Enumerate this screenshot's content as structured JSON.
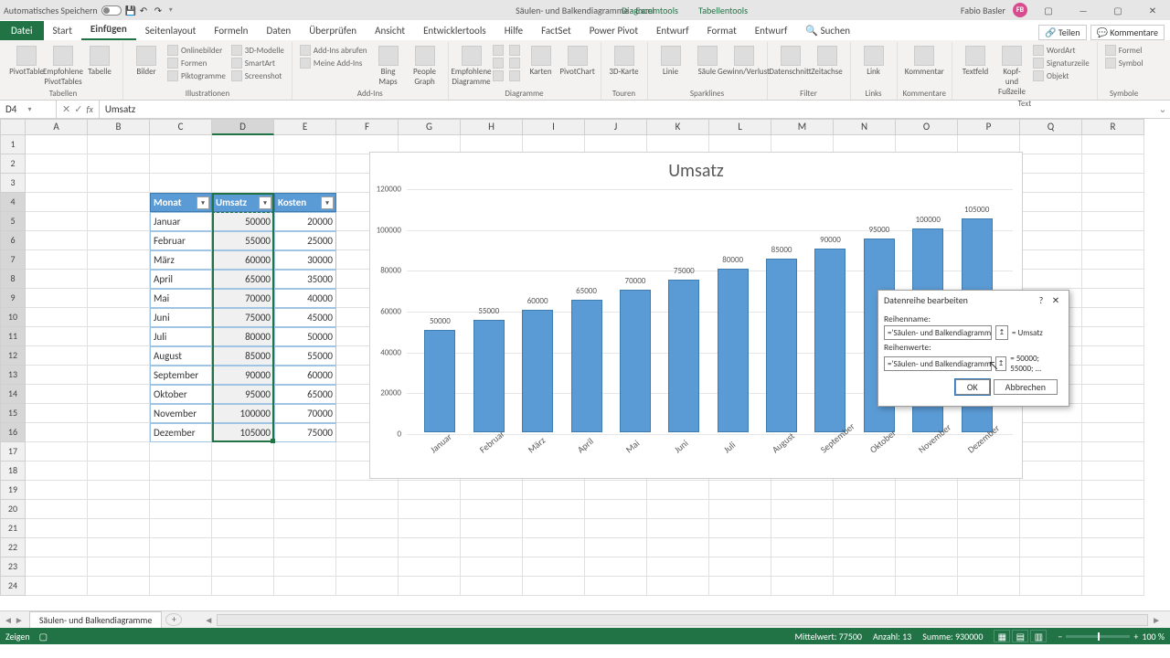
{
  "titlebar": {
    "autosave": "Automatisches Speichern",
    "doc_title": "Säulen- und Balkendiagramme - Excel",
    "tools1": "Diagrammtools",
    "tools2": "Tabellentools",
    "user": "Fabio Basler",
    "avatar": "FB"
  },
  "tabs": {
    "file": "Datei",
    "start": "Start",
    "einfugen": "Einfügen",
    "seitenlayout": "Seitenlayout",
    "formeln": "Formeln",
    "daten": "Daten",
    "uberprufen": "Überprüfen",
    "ansicht": "Ansicht",
    "entwickler": "Entwicklertools",
    "hilfe": "Hilfe",
    "factset": "FactSet",
    "powerpivot": "Power Pivot",
    "entwurf1": "Entwurf",
    "format": "Format",
    "entwurf2": "Entwurf",
    "suchen": "Suchen",
    "teilen": "Teilen",
    "kommentare": "Kommentare"
  },
  "ribbon": {
    "groups": {
      "tabellen": "Tabellen",
      "illustrationen": "Illustrationen",
      "addins": "Add-Ins",
      "diagramme": "Diagramme",
      "touren": "Touren",
      "sparklines": "Sparklines",
      "filter": "Filter",
      "links": "Links",
      "rkommentare": "Kommentare",
      "text": "Text",
      "symbole": "Symbole"
    },
    "btns": {
      "pivottable": "PivotTable",
      "empfpivot": "Empfohlene PivotTables",
      "tabelle": "Tabelle",
      "bilder": "Bilder",
      "onlinebilder": "Onlinebilder",
      "formen": "Formen",
      "piktogramme": "Piktogramme",
      "3dmodelle": "3D-Modelle",
      "smartart": "SmartArt",
      "screenshot": "Screenshot",
      "addinsabrufen": "Add-Ins abrufen",
      "meineaddins": "Meine Add-Ins",
      "bing": "Bing Maps",
      "people": "People Graph",
      "empfdiag": "Empfohlene Diagramme",
      "karten": "Karten",
      "pivotchart": "PivotChart",
      "3dkarte": "3D-Karte",
      "linie": "Linie",
      "saule": "Säule",
      "gewinn": "Gewinn/Verlust",
      "datenschnitt": "Datenschnitt",
      "zeitachse": "Zeitachse",
      "link": "Link",
      "kommentar": "Kommentar",
      "textfeld": "Textfeld",
      "kopfzeile": "Kopf- und Fußzeile",
      "wordart": "WordArt",
      "signatur": "Signaturzeile",
      "objekt": "Objekt",
      "formel": "Formel",
      "symbol": "Symbol"
    }
  },
  "namebox": "D4",
  "formula": "Umsatz",
  "headers": [
    "A",
    "B",
    "C",
    "D",
    "E",
    "F",
    "G",
    "H",
    "I",
    "J",
    "K",
    "L",
    "M",
    "N",
    "O",
    "P",
    "Q",
    "R"
  ],
  "table": {
    "hdr": {
      "c": "Monat",
      "d": "Umsatz",
      "e": "Kosten"
    },
    "rows": [
      {
        "c": "Januar",
        "d": "50000",
        "e": "20000"
      },
      {
        "c": "Februar",
        "d": "55000",
        "e": "25000"
      },
      {
        "c": "März",
        "d": "60000",
        "e": "30000"
      },
      {
        "c": "April",
        "d": "65000",
        "e": "35000"
      },
      {
        "c": "Mai",
        "d": "70000",
        "e": "40000"
      },
      {
        "c": "Juni",
        "d": "75000",
        "e": "45000"
      },
      {
        "c": "Juli",
        "d": "80000",
        "e": "50000"
      },
      {
        "c": "August",
        "d": "85000",
        "e": "55000"
      },
      {
        "c": "September",
        "d": "90000",
        "e": "60000"
      },
      {
        "c": "Oktober",
        "d": "95000",
        "e": "65000"
      },
      {
        "c": "November",
        "d": "100000",
        "e": "70000"
      },
      {
        "c": "Dezember",
        "d": "105000",
        "e": "75000"
      }
    ]
  },
  "chart_data": {
    "type": "bar",
    "title": "Umsatz",
    "categories": [
      "Januar",
      "Februar",
      "März",
      "April",
      "Mai",
      "Juni",
      "Juli",
      "August",
      "September",
      "Oktober",
      "November",
      "Dezember"
    ],
    "values": [
      50000,
      55000,
      60000,
      65000,
      70000,
      75000,
      80000,
      85000,
      90000,
      95000,
      100000,
      105000
    ],
    "ylim": [
      0,
      120000
    ],
    "yticks": [
      0,
      20000,
      40000,
      60000,
      80000,
      100000,
      120000
    ],
    "xlabel": "",
    "ylabel": ""
  },
  "dialog": {
    "title": "Datenreihe bearbeiten",
    "name_label": "Reihenname:",
    "name_val": "='Säulen- und Balkendiagramme'",
    "name_eq": "= Umsatz",
    "values_label": "Reihenwerte:",
    "values_val": "='Säulen- und Balkendiagramme'",
    "values_eq": "= 50000; 55000; ...",
    "ok": "OK",
    "cancel": "Abbrechen"
  },
  "sheettab": "Säulen- und Balkendiagramme",
  "status": {
    "mode": "Zeigen",
    "mittelwert": "Mittelwert: 77500",
    "anzahl": "Anzahl: 13",
    "summe": "Summe: 930000",
    "zoom": "100 %"
  }
}
